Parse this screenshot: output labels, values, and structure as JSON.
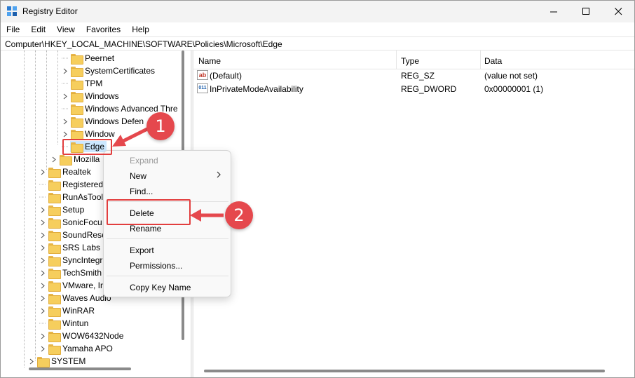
{
  "window": {
    "title": "Registry Editor",
    "minimize_icon": "minimize-icon",
    "maximize_icon": "maximize-icon",
    "close_icon": "close-icon"
  },
  "menubar": [
    "File",
    "Edit",
    "View",
    "Favorites",
    "Help"
  ],
  "address": "Computer\\HKEY_LOCAL_MACHINE\\SOFTWARE\\Policies\\Microsoft\\Edge",
  "tree": {
    "nested_items": [
      {
        "label": "Peernet",
        "expandable": false
      },
      {
        "label": "SystemCertificates",
        "expandable": true
      },
      {
        "label": "TPM",
        "expandable": false
      },
      {
        "label": "Windows",
        "expandable": true
      },
      {
        "label": "Windows Advanced Thre",
        "expandable": false
      },
      {
        "label": "Windows Defen",
        "expandable": true
      },
      {
        "label": "Window",
        "expandable": true
      },
      {
        "label": "Edge",
        "expandable": false
      }
    ],
    "mid_items": [
      {
        "label": "Mozilla",
        "expandable": true
      }
    ],
    "top_items": [
      {
        "label": "Realtek",
        "expandable": true
      },
      {
        "label": "Registered",
        "expandable": false
      },
      {
        "label": "RunAsTool",
        "expandable": false
      },
      {
        "label": "Setup",
        "expandable": true
      },
      {
        "label": "SonicFocu",
        "expandable": true
      },
      {
        "label": "SoundRese",
        "expandable": true
      },
      {
        "label": "SRS Labs",
        "expandable": true
      },
      {
        "label": "SyncIntegr",
        "expandable": true
      },
      {
        "label": "TechSmith",
        "expandable": true
      },
      {
        "label": "VMware, In",
        "expandable": true
      },
      {
        "label": "Waves Audio",
        "expandable": true
      },
      {
        "label": "WinRAR",
        "expandable": true
      },
      {
        "label": "Wintun",
        "expandable": false
      },
      {
        "label": "WOW6432Node",
        "expandable": true
      },
      {
        "label": "Yamaha APO",
        "expandable": true
      }
    ],
    "root_items": [
      {
        "label": "SYSTEM",
        "expandable": true
      }
    ]
  },
  "list": {
    "columns": [
      "Name",
      "Type",
      "Data"
    ],
    "rows": [
      {
        "icon": "string-value-icon",
        "icon_text": "ab",
        "name": "(Default)",
        "type": "REG_SZ",
        "data": "(value not set)"
      },
      {
        "icon": "binary-value-icon",
        "icon_text": "011",
        "name": "InPrivateModeAvailability",
        "type": "REG_DWORD",
        "data": "0x00000001 (1)"
      }
    ]
  },
  "context_menu": {
    "items": [
      {
        "label": "Expand",
        "disabled": true
      },
      {
        "label": "New",
        "submenu": true
      },
      {
        "label": "Find..."
      },
      {
        "label": "Delete"
      },
      {
        "label": "Rename"
      },
      {
        "label": "Export"
      },
      {
        "label": "Permissions..."
      },
      {
        "label": "Copy Key Name"
      }
    ]
  },
  "annotations": {
    "step1": "1",
    "step2": "2",
    "color": "#e5484d"
  },
  "colors": {
    "selection": "#cce8ff",
    "folder": "#f6ce5d",
    "callout": "#e23e3e"
  }
}
